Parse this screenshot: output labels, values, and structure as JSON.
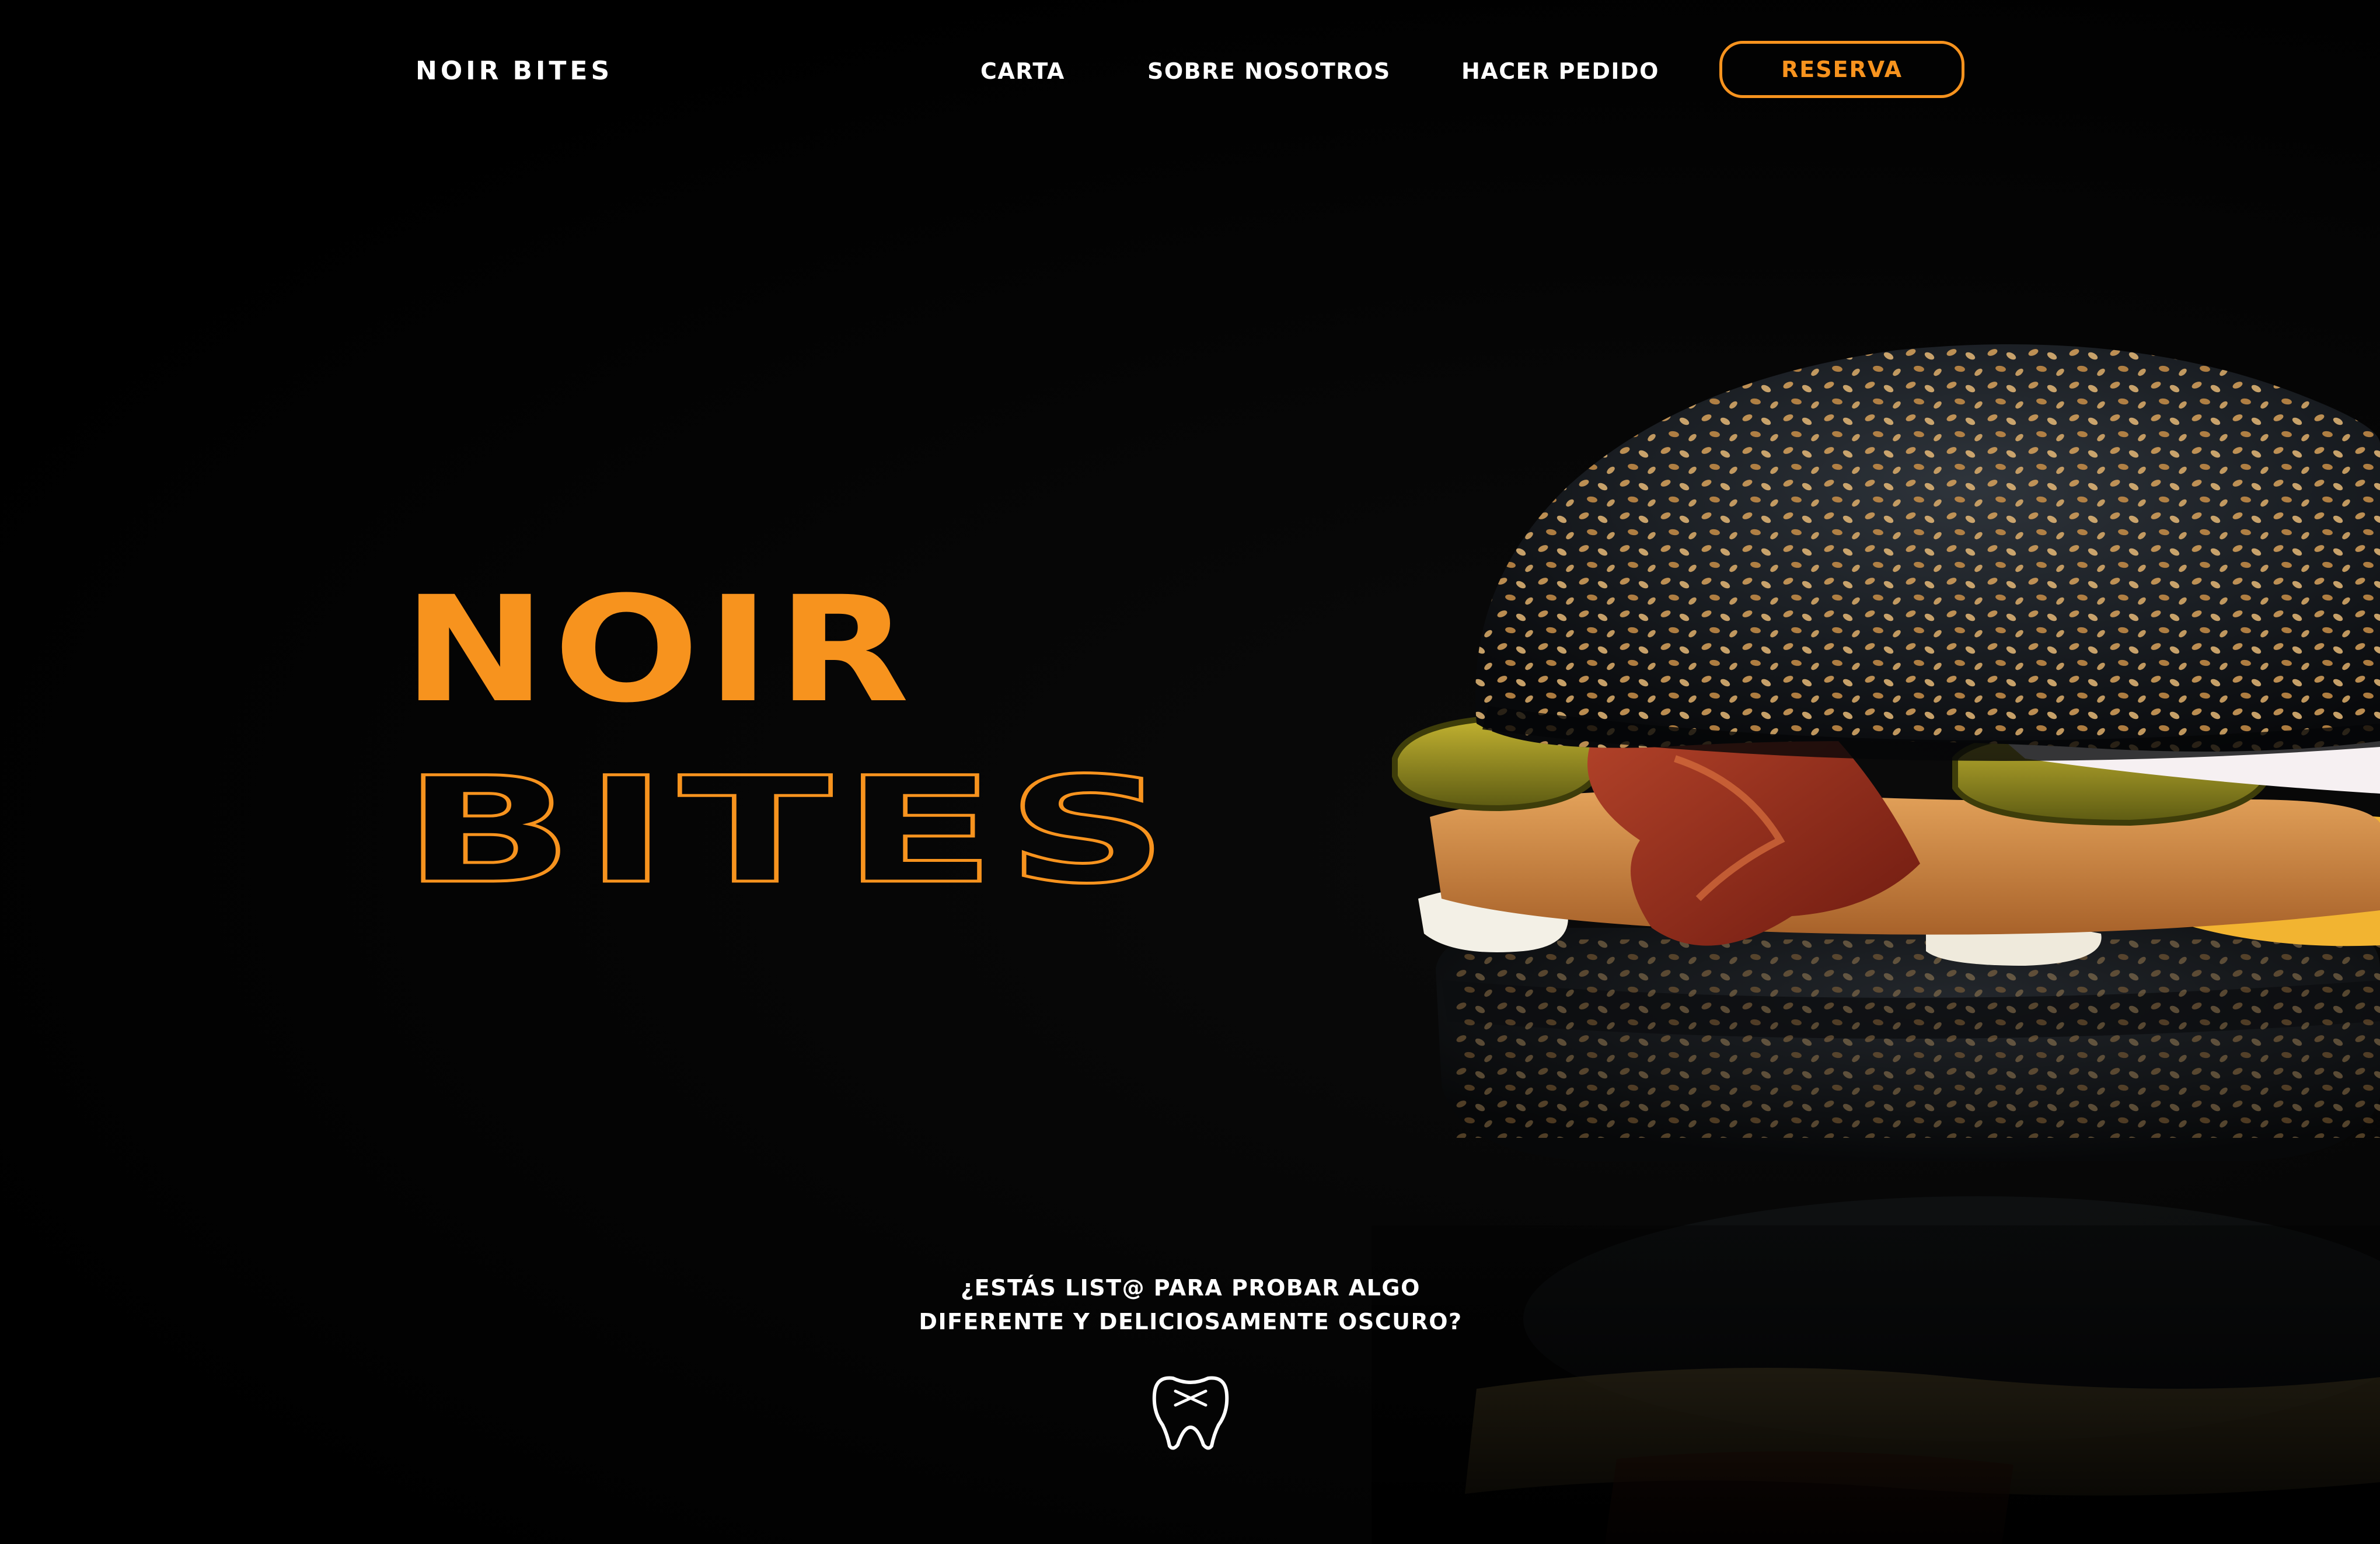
{
  "brand": {
    "logo_word1": "NOIR",
    "logo_word2": "BITES",
    "accent_color": "#f7931e"
  },
  "nav": {
    "items": [
      {
        "label": "CARTA"
      },
      {
        "label": "SOBRE NOSOTROS"
      },
      {
        "label": "HACER PEDIDO"
      }
    ],
    "cta_label": "RESERVA"
  },
  "hero": {
    "title_line1": "NOIR",
    "title_line2": "BITES",
    "tagline_line1": "¿ESTÁS LIST@ PARA PROBAR ALGO",
    "tagline_line2": "DIFERENTE Y DELICIOSAMENTE OSCURO?"
  },
  "icons": {
    "scroll_icon": "tooth-icon",
    "hero_image": "black-burger-image"
  }
}
